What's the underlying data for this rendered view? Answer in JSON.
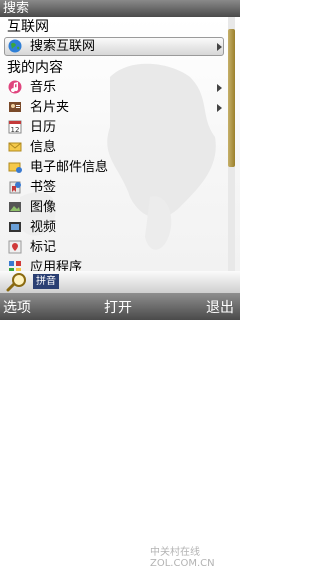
{
  "title_bar": {
    "title": "搜索"
  },
  "sections": {
    "internet": "互联网",
    "my_content": "我的内容"
  },
  "internet_items": [
    {
      "label": "搜索互联网",
      "icon": "globe-icon"
    }
  ],
  "content_items": [
    {
      "label": "音乐",
      "icon": "music-icon",
      "submenu": true
    },
    {
      "label": "名片夹",
      "icon": "contacts-icon",
      "submenu": true
    },
    {
      "label": "日历",
      "icon": "calendar-icon"
    },
    {
      "label": "信息",
      "icon": "envelope-icon"
    },
    {
      "label": "电子邮件信息",
      "icon": "email-icon"
    },
    {
      "label": "书签",
      "icon": "bookmark-icon"
    },
    {
      "label": "图像",
      "icon": "image-icon"
    },
    {
      "label": "视频",
      "icon": "video-icon"
    },
    {
      "label": "标记",
      "icon": "landmark-icon"
    },
    {
      "label": "应用程序",
      "icon": "apps-icon"
    }
  ],
  "search_bar": {
    "input_mode": "拼音",
    "icon": "magnifier-icon"
  },
  "softkeys": {
    "left": "选项",
    "middle": "打开",
    "right": "退出"
  },
  "watermark": {
    "text": "中关村在线 ZOL.COM.CN"
  },
  "colors": {
    "title_bar": "#4a4a4a",
    "scroll_thumb": "#b39b4c",
    "pinyin_bg": "#2a3f73"
  }
}
